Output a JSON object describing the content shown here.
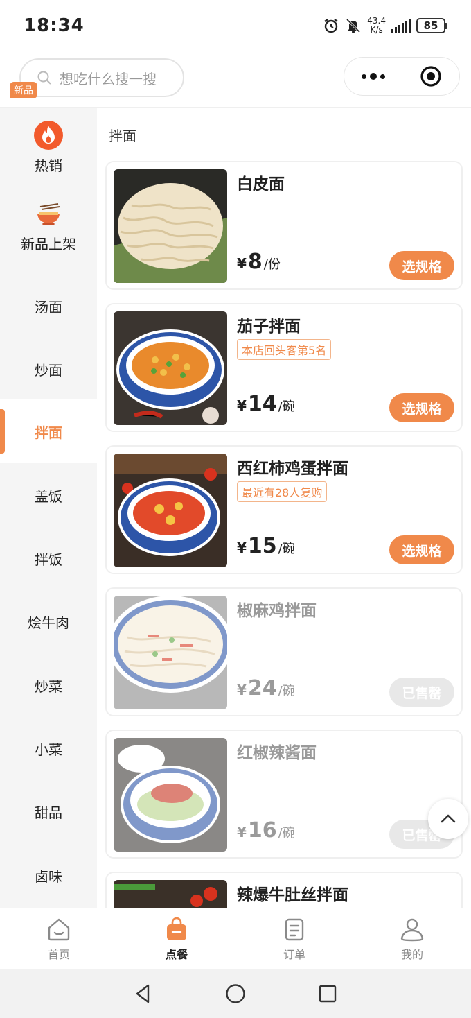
{
  "status_bar": {
    "time": "18:34",
    "speed_value": "43.4",
    "speed_unit": "K/s",
    "battery": "85",
    "icons": [
      "alarm-icon",
      "mute-bell-icon",
      "signal-icon",
      "battery-icon"
    ]
  },
  "search": {
    "placeholder": "想吃什么搜一搜"
  },
  "capsule": {
    "icons": [
      "more-dots-icon",
      "target-icon"
    ]
  },
  "sidebar": {
    "new_tag": "新品",
    "items": [
      {
        "label": "热销",
        "icon": "fire-icon"
      },
      {
        "label": "新品上架",
        "icon": "noodle-bowl-icon"
      },
      {
        "label": "汤面"
      },
      {
        "label": "炒面"
      },
      {
        "label": "拌面",
        "active": true
      },
      {
        "label": "盖饭"
      },
      {
        "label": "拌饭"
      },
      {
        "label": "烩牛肉"
      },
      {
        "label": "炒菜"
      },
      {
        "label": "小菜"
      },
      {
        "label": "甜品"
      },
      {
        "label": "卤味"
      }
    ]
  },
  "section_title": "拌面",
  "products": [
    {
      "name": "白皮面",
      "badge": "",
      "currency": "¥",
      "price": "8",
      "unit": "/份",
      "button": "选规格",
      "sold_out": false
    },
    {
      "name": "茄子拌面",
      "badge": "本店回头客第5名",
      "currency": "¥",
      "price": "14",
      "unit": "/碗",
      "button": "选规格",
      "sold_out": false
    },
    {
      "name": "西红柿鸡蛋拌面",
      "badge": "最近有28人复购",
      "currency": "¥",
      "price": "15",
      "unit": "/碗",
      "button": "选规格",
      "sold_out": false
    },
    {
      "name": "椒麻鸡拌面",
      "badge": "",
      "currency": "¥",
      "price": "24",
      "unit": "/碗",
      "button": "已售罄",
      "sold_out": true
    },
    {
      "name": "红椒辣酱面",
      "badge": "",
      "currency": "¥",
      "price": "16",
      "unit": "/碗",
      "button": "已售罄",
      "sold_out": true
    },
    {
      "name": "辣爆牛肚丝拌面",
      "badge": "",
      "currency": "¥",
      "price": "",
      "unit": "",
      "button": "",
      "sold_out": false
    }
  ],
  "tabbar": [
    {
      "label": "首页",
      "icon": "home-icon"
    },
    {
      "label": "点餐",
      "icon": "bag-icon",
      "active": true
    },
    {
      "label": "订单",
      "icon": "order-icon"
    },
    {
      "label": "我的",
      "icon": "profile-icon"
    }
  ],
  "colors": {
    "accent": "#f0894a",
    "sidebar_bg": "#f5f5f5",
    "sold_out_btn": "#e8e8e8"
  }
}
